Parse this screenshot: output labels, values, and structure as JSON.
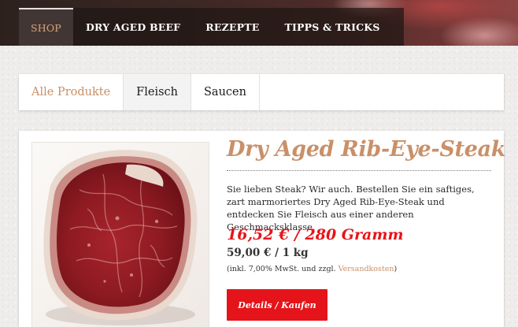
{
  "nav": {
    "items": [
      {
        "label": "SHOP",
        "active": true
      },
      {
        "label": "DRY AGED BEEF",
        "active": false
      },
      {
        "label": "REZEPTE",
        "active": false
      },
      {
        "label": "TIPPS & TRICKS",
        "active": false
      }
    ]
  },
  "tabs": {
    "items": [
      {
        "label": "Alle Produkte",
        "active": true
      },
      {
        "label": "Fleisch",
        "active": false
      },
      {
        "label": "Saucen",
        "active": false
      }
    ]
  },
  "product": {
    "title": "Dry Aged Rib-Eye-Steak",
    "description": "Sie lieben Steak? Wir auch. Bestellen Sie ein saftiges, zart marmoriertes Dry Aged Rib-Eye-Steak und entdecken Sie Fleisch aus einer anderen Geschmacksklasse.",
    "price": "16,52 € / 280 Gramm",
    "unit_price": "59,00 € / 1 kg",
    "tax_prefix": "(inkl. 7,00% MwSt. und zzgl. ",
    "tax_link": "Versandkosten",
    "tax_suffix": ")",
    "button_label": "Details / Kaufen",
    "image_icon": "steak-photo"
  },
  "colors": {
    "accent": "#c99068",
    "price_red": "#e8141a",
    "button_red": "#e4141a",
    "nav_dark": "#2d211e"
  }
}
